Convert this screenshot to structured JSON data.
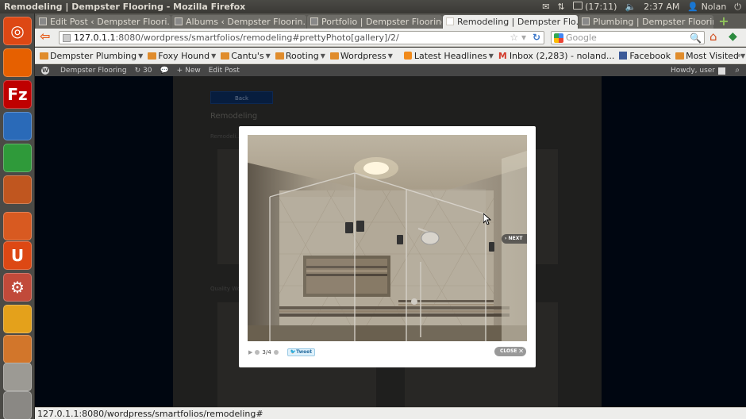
{
  "window": {
    "title": "Remodeling | Dempster Flooring - Mozilla Firefox"
  },
  "system": {
    "battery": "(17:11)",
    "clock": "2:37 AM",
    "user": "Nolan"
  },
  "tabs": [
    {
      "label": "Edit Post ‹ Dempster Floori...",
      "active": false
    },
    {
      "label": "Albums ‹ Dempster Floorin...",
      "active": false
    },
    {
      "label": "Portfolio | Dempster Flooring",
      "active": false
    },
    {
      "label": "Remodeling | Dempster Flo...",
      "active": true
    },
    {
      "label": "Plumbing | Dempster Flooring",
      "active": false
    }
  ],
  "address": {
    "host": "127.0.1.1",
    "rest": ":8080/wordpress/smartfolios/remodeling#prettyPhoto[gallery]/2/"
  },
  "search": {
    "placeholder": "Google"
  },
  "bookmarks": [
    {
      "label": "Dempster Plumbing",
      "type": "folder",
      "dropdown": true
    },
    {
      "label": "Foxy Hound",
      "type": "folder",
      "dropdown": true
    },
    {
      "label": "Cantu's",
      "type": "folder",
      "dropdown": true
    },
    {
      "label": "Rooting",
      "type": "folder",
      "dropdown": true
    },
    {
      "label": "Wordpress",
      "type": "folder",
      "dropdown": true
    },
    {
      "label": "Latest Headlines",
      "type": "rss",
      "dropdown": true
    },
    {
      "label": "Inbox (2,283) - noland...",
      "type": "gmail",
      "dropdown": false
    },
    {
      "label": "Facebook",
      "type": "facebook",
      "dropdown": false
    },
    {
      "label": "Most Visited",
      "type": "folder",
      "dropdown": true
    }
  ],
  "wp_admin_bar": {
    "site": "Dempster Flooring",
    "updates": "30",
    "new_label": "New",
    "edit_label": "Edit Post",
    "howdy": "Howdy, user"
  },
  "page": {
    "back_label": "Back",
    "heading": "Remodeling"
  },
  "lightbox": {
    "counter": "3/4",
    "tweet_label": "Tweet",
    "next_label": "NEXT",
    "close_label": "CLOSE"
  },
  "status": {
    "url": "127.0.1.1:8080/wordpress/smartfolios/remodeling#"
  },
  "launcher": [
    {
      "name": "ubuntu-dash-icon",
      "glyph": "◎",
      "color": "#dd4814"
    },
    {
      "name": "firefox-icon",
      "glyph": "",
      "color": "#e66000"
    },
    {
      "name": "filezilla-icon",
      "glyph": "Fz",
      "color": "#bf0000"
    },
    {
      "name": "writer-icon",
      "glyph": "",
      "color": "#2a6ab8"
    },
    {
      "name": "calc-icon",
      "glyph": "",
      "color": "#2f9a3a"
    },
    {
      "name": "impress-icon",
      "glyph": "",
      "color": "#c0561f"
    },
    {
      "name": "software-center-icon",
      "glyph": "",
      "color": "#d85a21"
    },
    {
      "name": "ubuntu-one-icon",
      "glyph": "U",
      "color": "#dd4814"
    },
    {
      "name": "system-settings-icon",
      "glyph": "⚙",
      "color": "#c14a3a"
    },
    {
      "name": "picasa-icon",
      "glyph": "",
      "color": "#e4a11b"
    },
    {
      "name": "files-icon",
      "glyph": "",
      "color": "#d2762b"
    },
    {
      "name": "workspaces-icon",
      "glyph": "",
      "color": "#9c9a94"
    },
    {
      "name": "trash-icon",
      "glyph": "",
      "color": "#8a8884"
    }
  ]
}
